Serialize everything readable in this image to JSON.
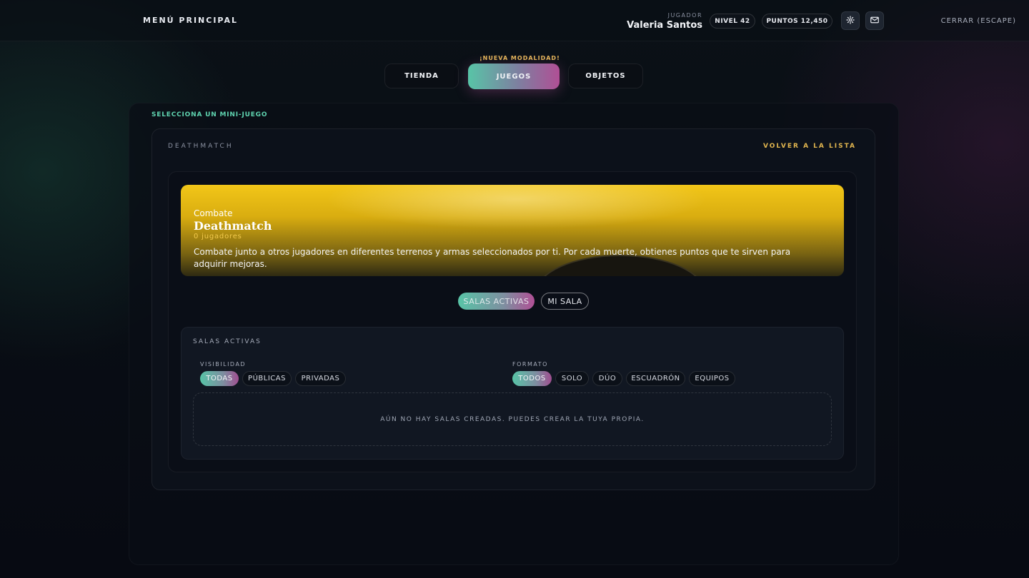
{
  "header": {
    "menu_title": "MENÚ PRINCIPAL",
    "player_label": "JUGADOR",
    "player_name": "Valeria Santos",
    "level": "NIVEL 42",
    "points": "PUNTOS 12,450",
    "settings_icon": "gear-icon",
    "mail_icon": "mail-icon",
    "close_label": "CERRAR (ESCAPE)"
  },
  "tabs": {
    "badge": "¡NUEVA MODALIDAD!",
    "items": [
      {
        "label": "TIENDA",
        "active": false
      },
      {
        "label": "JUEGOS",
        "active": true
      },
      {
        "label": "OBJETOS",
        "active": false
      }
    ]
  },
  "main": {
    "select_label": "SELECCIONA UN MINI-JUEGO",
    "game_label": "DEATHMATCH",
    "back_label": "VOLVER A LA LISTA",
    "banner": {
      "category": "Combate",
      "title": "Deathmatch",
      "players": "0 jugadores",
      "description": "Combate junto a otros jugadores en diferentes terrenos y armas seleccionados por ti. Por cada muerte, obtienes puntos que te sirven para adquirir mejoras."
    },
    "subtabs": [
      {
        "label": "SALAS ACTIVAS",
        "active": true
      },
      {
        "label": "MI SALA",
        "active": false
      }
    ],
    "salas": {
      "title": "SALAS ACTIVAS",
      "visibility_label": "VISIBILIDAD",
      "visibility_options": [
        "TODAS",
        "PÚBLICAS",
        "PRIVADAS"
      ],
      "format_label": "FORMATO",
      "format_options": [
        "TODOS",
        "SOLO",
        "DÚO",
        "ESCUADRÓN",
        "EQUIPOS"
      ],
      "empty_message": "AÚN NO HAY SALAS CREADAS. PUEDES CREAR LA TUYA PROPIA."
    }
  },
  "colors": {
    "accent_green": "#58c4a7",
    "accent_pink": "#b04f95",
    "accent_gold": "#e2b64f",
    "banner_yellow": "#f2c618"
  }
}
